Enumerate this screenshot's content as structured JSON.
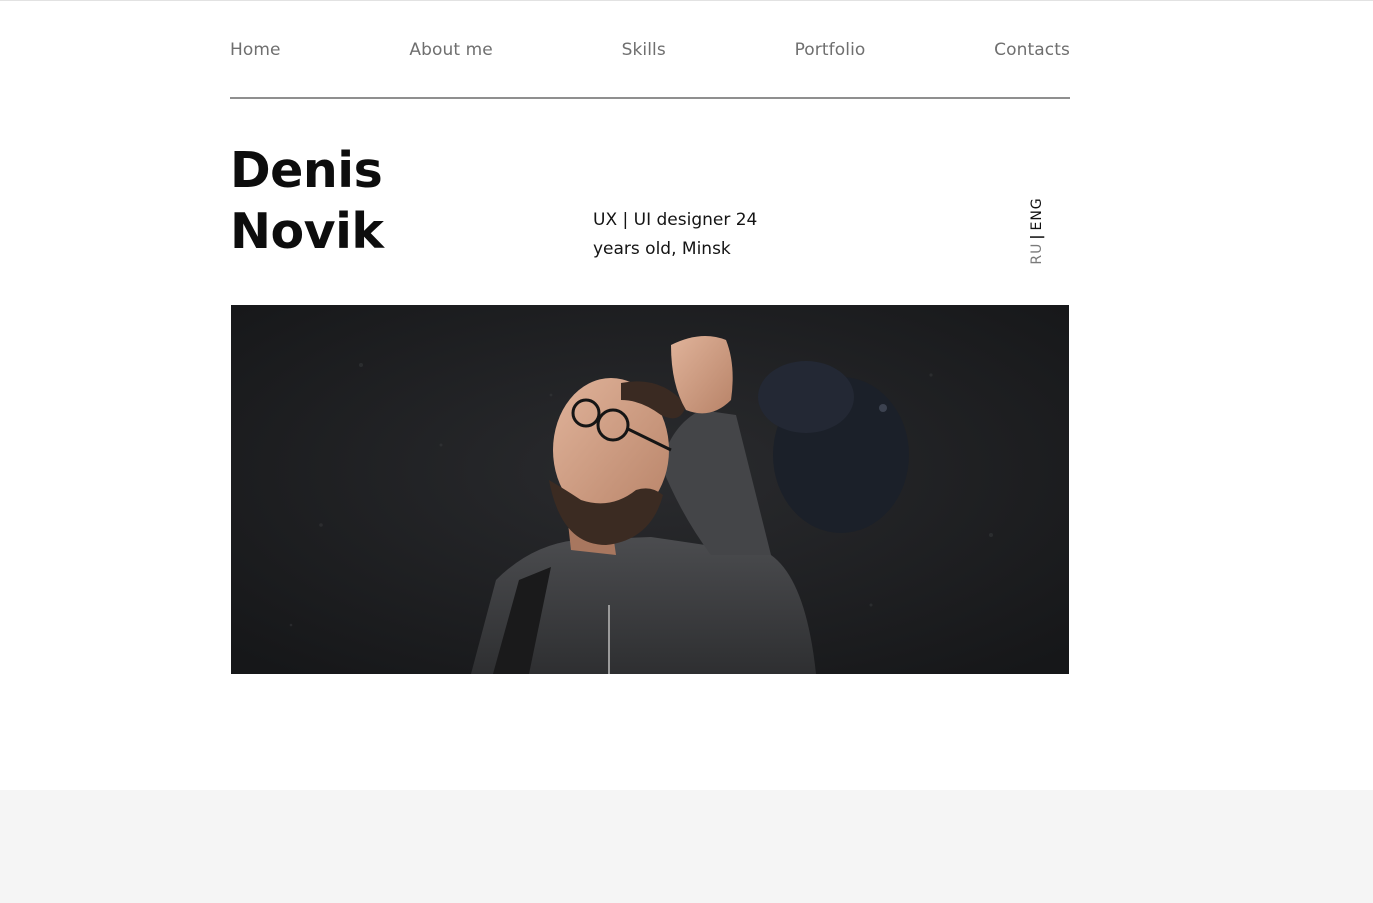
{
  "nav": {
    "items": [
      {
        "label": "Home"
      },
      {
        "label": "About me"
      },
      {
        "label": "Skills"
      },
      {
        "label": "Portfolio"
      },
      {
        "label": "Contacts"
      }
    ]
  },
  "hero": {
    "first_name": "Denis",
    "last_name": "Novik",
    "tagline_line1": "UX | UI designer 24",
    "tagline_line2": "years old, Minsk",
    "photo_subject": "bearded man with glasses holding a cap against a dark wall"
  },
  "language": {
    "options": [
      "RU",
      "ENG"
    ],
    "separator": "|",
    "active": "ENG"
  },
  "colors": {
    "nav_text": "#6f6f6f",
    "heading": "#0d0d0d",
    "divider": "#8f8f8f",
    "photo_bg": "#1e1f21",
    "footer_bg": "#f5f5f5"
  }
}
